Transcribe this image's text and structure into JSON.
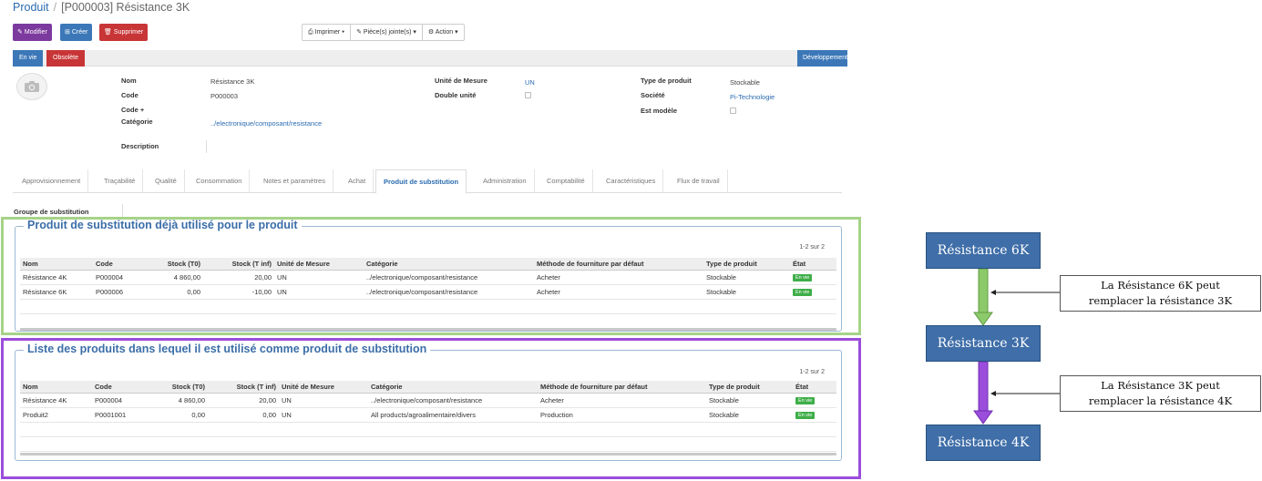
{
  "breadcrumb": {
    "parent": "Produit",
    "separator": "/",
    "current": "[P000003] Résistance 3K"
  },
  "toolbar": {
    "edit_label": "Modifier",
    "create_label": "Créer",
    "delete_label": "Supprimer",
    "print_label": "Imprimer",
    "attachments_label": "Pièce(s) jointe(s)",
    "action_label": "Action"
  },
  "statusbar": {
    "active_label": "En vie",
    "obsolete_label": "Obsolète",
    "dev_label": "Développement"
  },
  "form": {
    "nom_label": "Nom",
    "nom_value": "Résistance 3K",
    "code_label": "Code",
    "code_value": "P000003",
    "code_plus_label": "Code +",
    "categorie_label": "Catégorie",
    "categorie_value": "../electronique/composant/resistance",
    "description_label": "Description",
    "uom_label": "Unité de Mesure",
    "uom_value": "UN",
    "double_unit_label": "Double unité",
    "type_label": "Type de produit",
    "type_value": "Stockable",
    "societe_label": "Société",
    "societe_value": "Pi-Technologie",
    "modele_label": "Est modèle"
  },
  "tabs": [
    "Approvisionnement",
    "Traçabilité",
    "Qualité",
    "Consommation",
    "Notes et paramètres",
    "Achat",
    "Produit de substitution",
    "Administration",
    "Comptabilité",
    "Caractéristiques",
    "Flux de travail"
  ],
  "group_label": "Groupe de substitution",
  "section1": {
    "title": "Produit de substitution déjà utilisé pour le produit",
    "counter": "1-2 sur 2",
    "columns": [
      "Nom",
      "Code",
      "Stock (T0)",
      "Stock (T inf)",
      "Unité de Mesure",
      "Catégorie",
      "Méthode de fourniture par défaut",
      "Type de produit",
      "État"
    ],
    "rows": [
      [
        "Résistance 4K",
        "P000004",
        "4 860,00",
        "20,00",
        "UN",
        "../electronique/composant/resistance",
        "Acheter",
        "Stockable",
        "En vie"
      ],
      [
        "Résistance 6K",
        "P000006",
        "0,00",
        "-10,00",
        "UN",
        "../electronique/composant/resistance",
        "Acheter",
        "Stockable",
        "En vie"
      ]
    ]
  },
  "section2": {
    "title": "Liste des produits dans lequel il est utilisé comme produit de substitution",
    "counter": "1-2 sur 2",
    "columns": [
      "Nom",
      "Code",
      "Stock (T0)",
      "Stock (T inf)",
      "Unité de Mesure",
      "Catégorie",
      "Méthode de fourniture par défaut",
      "Type de produit",
      "État"
    ],
    "rows": [
      [
        "Résistance 4K",
        "P000004",
        "4 860,00",
        "20,00",
        "UN",
        "../electronique/composant/resistance",
        "Acheter",
        "Stockable",
        "En vie"
      ],
      [
        "Produit2",
        "P0001001",
        "0,00",
        "0,00",
        "UN",
        "All products/agroalimentaire/divers",
        "Production",
        "Stockable",
        "En vie"
      ]
    ]
  },
  "diagram": {
    "node_top": "Résistance 6K",
    "node_mid": "Résistance 3K",
    "node_bottom": "Résistance 4K",
    "note1_line1": "La Résistance 6K peut",
    "note1_line2": "remplacer la résistance 3K",
    "note2_line1": "La Résistance 3K peut",
    "note2_line2": "remplacer la résistance 4K"
  },
  "colors": {
    "green_highlight": "#a6d387",
    "purple_highlight": "#9b4ddc",
    "arrow_green": "#8cc96a",
    "arrow_purple": "#9b4ddc",
    "node_fill": "#3f6ea8",
    "badge_green": "#3fae49"
  },
  "icons": {
    "edit": "pencil-icon",
    "create": "plus-square-icon",
    "delete": "trash-icon",
    "print": "printer-icon",
    "attachments": "paperclip-icon",
    "action": "gear-icon",
    "avatar": "camera-icon"
  }
}
